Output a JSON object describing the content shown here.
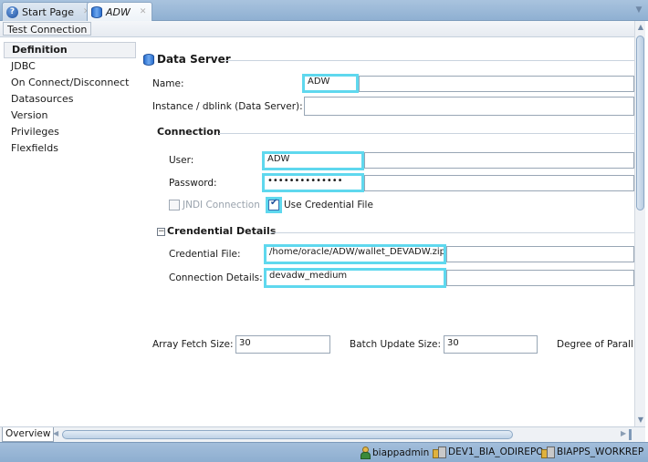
{
  "tabs": [
    {
      "label": "Start Page",
      "icon": "help-icon",
      "active": false
    },
    {
      "label": "ADW",
      "icon": "data-server-icon",
      "active": true
    }
  ],
  "toolbar": {
    "test_connection_label": "Test Connection"
  },
  "nav": {
    "items": [
      {
        "label": "Definition",
        "selected": true
      },
      {
        "label": "JDBC"
      },
      {
        "label": "On Connect/Disconnect"
      },
      {
        "label": "Datasources"
      },
      {
        "label": "Version"
      },
      {
        "label": "Privileges"
      },
      {
        "label": "Flexfields"
      }
    ]
  },
  "main": {
    "title": "Data Server",
    "name_label": "Name:",
    "name_value": "ADW",
    "instance_label": "Instance / dblink (Data Server):",
    "instance_value": "",
    "connection": {
      "title": "Connection",
      "user_label": "User:",
      "user_value": "ADW",
      "password_label": "Password:",
      "password_value": "••••••••••••••",
      "jndi_label": "JNDI Connection",
      "jndi_checked": false,
      "use_credential_label": "Use Credential File",
      "use_credential_checked": true
    },
    "credential": {
      "title": "Crendential Details",
      "file_label": "Credential File:",
      "file_value": "/home/oracle/ADW/wallet_DEVADW.zip",
      "details_label": "Connection Details:",
      "details_value": "devadw_medium"
    },
    "fetch": {
      "array_label": "Array Fetch Size:",
      "array_value": "30",
      "batch_label": "Batch Update Size:",
      "batch_value": "30",
      "degree_label": "Degree of Parall"
    }
  },
  "bottom": {
    "overview_label": "Overview"
  },
  "status": {
    "user": "biappadmin",
    "master_repo": "DEV1_BIA_ODIREPO",
    "work_repo": "BIAPPS_WORKREP"
  },
  "colors": {
    "highlight": "#5fd8ee",
    "status_bar": "#9bb8d8"
  }
}
